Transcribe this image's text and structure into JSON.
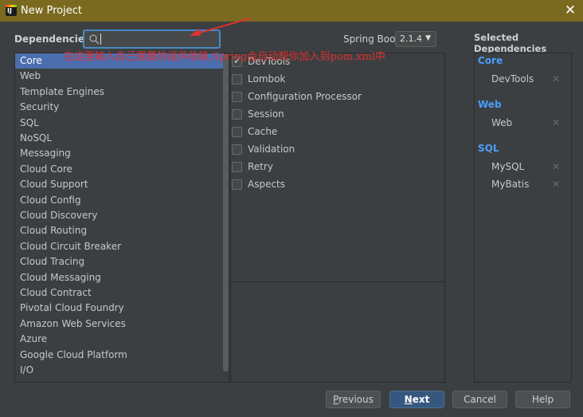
{
  "window": {
    "title": "New Project",
    "icon": "intellij-icon"
  },
  "dependencies_label": "Dependencies",
  "search": {
    "value": "",
    "placeholder": ""
  },
  "spring_boot": {
    "label": "Spring Boot",
    "version": "2.1.4"
  },
  "selected_title": "Selected Dependencies",
  "categories": [
    "Core",
    "Web",
    "Template Engines",
    "Security",
    "SQL",
    "NoSQL",
    "Messaging",
    "Cloud Core",
    "Cloud Support",
    "Cloud Config",
    "Cloud Discovery",
    "Cloud Routing",
    "Cloud Circuit Breaker",
    "Cloud Tracing",
    "Cloud Messaging",
    "Cloud Contract",
    "Pivotal Cloud Foundry",
    "Amazon Web Services",
    "Azure",
    "Google Cloud Platform",
    "I/O"
  ],
  "selected_category": "Core",
  "core_dependencies": [
    {
      "label": "DevTools",
      "checked": true
    },
    {
      "label": "Lombok",
      "checked": false
    },
    {
      "label": "Configuration Processor",
      "checked": false
    },
    {
      "label": "Session",
      "checked": false
    },
    {
      "label": "Cache",
      "checked": false
    },
    {
      "label": "Validation",
      "checked": false
    },
    {
      "label": "Retry",
      "checked": false
    },
    {
      "label": "Aspects",
      "checked": false
    }
  ],
  "selected_dependencies": [
    {
      "group": "Core",
      "items": [
        "DevTools"
      ]
    },
    {
      "group": "Web",
      "items": [
        "Web"
      ]
    },
    {
      "group": "SQL",
      "items": [
        "MySQL",
        "MyBatis"
      ]
    }
  ],
  "annotation": "在这里输入自己需要的组件依赖,Spring会自动帮你加入到pom.xml中",
  "buttons": {
    "previous": {
      "mnemonic": "P",
      "rest": "revious"
    },
    "next": {
      "mnemonic": "N",
      "rest": "ext"
    },
    "cancel": "Cancel",
    "help": "Help"
  },
  "colors": {
    "titlebar": "#7a6a1f",
    "selection": "#4b6eaf",
    "accent": "#4a9eff",
    "annotation": "#e03030"
  }
}
